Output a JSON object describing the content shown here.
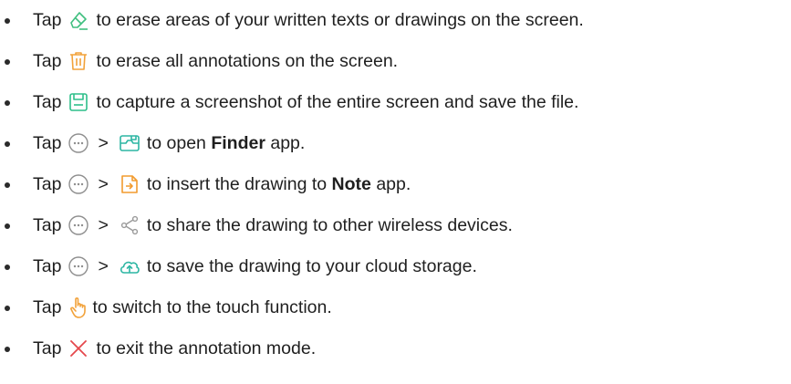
{
  "colors": {
    "erase_green": "#3fbf7f",
    "clear_orange": "#f2a23a",
    "screenshot_green": "#2ebf8a",
    "more_gray": "#8e8e8e",
    "finder_teal": "#2db6a3",
    "note_orange": "#f29b2e",
    "share_gray": "#9a9a9a",
    "cloud_teal": "#2db6a3",
    "touch_orange": "#f2a23a",
    "exit_red": "#e5484d"
  },
  "items": [
    {
      "tap": "Tap",
      "icon": "eraser-icon",
      "after": "to erase areas of your written texts or drawings on the screen."
    },
    {
      "tap": "Tap",
      "icon": "trash-icon",
      "after": "to erase all annotations on the screen."
    },
    {
      "tap": "Tap",
      "icon": "save-icon",
      "after": "to capture a screenshot of the entire screen and save the file."
    },
    {
      "tap": "Tap",
      "icon": "more-icon",
      "gt": ">",
      "icon2": "finder-icon",
      "after_pre": "to open",
      "bold": "Finder",
      "after_post": "app."
    },
    {
      "tap": "Tap",
      "icon": "more-icon",
      "gt": ">",
      "icon2": "insert-note-icon",
      "after_pre": "to insert the drawing to",
      "bold": "Note",
      "after_post": "app."
    },
    {
      "tap": "Tap",
      "icon": "more-icon",
      "gt": ">",
      "icon2": "share-icon",
      "after": "to share the drawing to other wireless devices."
    },
    {
      "tap": "Tap",
      "icon": "more-icon",
      "gt": ">",
      "icon2": "cloud-upload-icon",
      "after": "to save the drawing to your cloud storage."
    },
    {
      "tap": "Tap",
      "icon": "hand-touch-icon",
      "after": "to switch to the touch function."
    },
    {
      "tap": "Tap",
      "icon": "close-icon",
      "after": "to exit the annotation mode."
    }
  ]
}
